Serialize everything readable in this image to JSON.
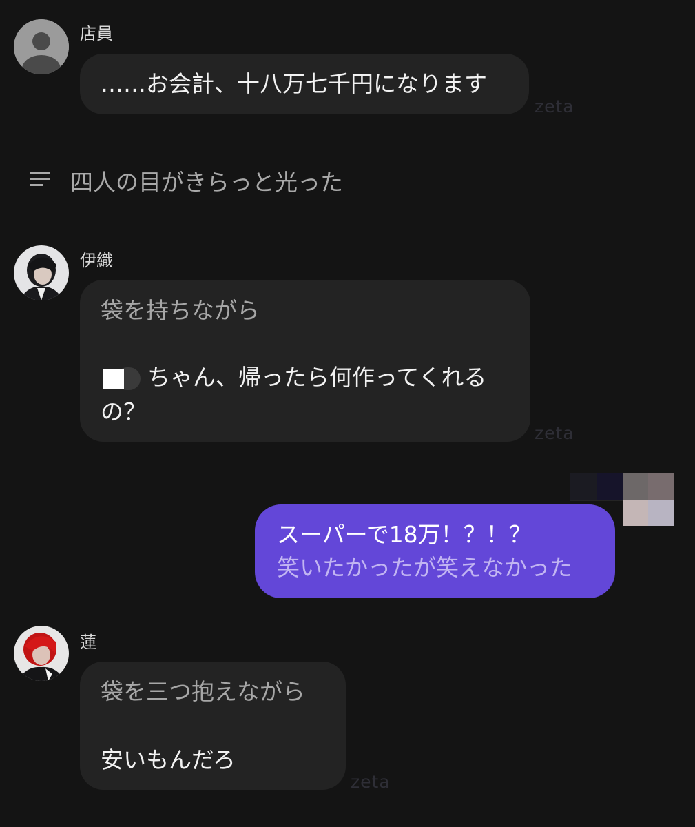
{
  "messages": [
    {
      "speaker": "店員",
      "lines": [
        "……お会計、十八万七千円になります"
      ],
      "watermark": "zeta"
    },
    {
      "type": "narration",
      "icon": "list-icon",
      "text": "四人の目がきらっと光った"
    },
    {
      "speaker": "伊織",
      "narration": "袋を持ちながら",
      "dialogue_1": "ちゃん、帰ったら何作ってくれる",
      "dialogue_2": "の？",
      "watermark": "zeta"
    },
    {
      "speaker": "user",
      "line1": "スーパーで18万！？！？",
      "line2": "笑いたかったが笑えなかった"
    },
    {
      "speaker": "蓮",
      "narration": "袋を三つ抱えながら",
      "dialogue": "安いもんだろ",
      "watermark": "zeta"
    }
  ],
  "colors": {
    "background": "#141414",
    "bubble": "#232323",
    "user_bubble": "#6347d8",
    "narration_text": "#a7a7a7",
    "user_secondary_text": "#c2b5f2"
  }
}
